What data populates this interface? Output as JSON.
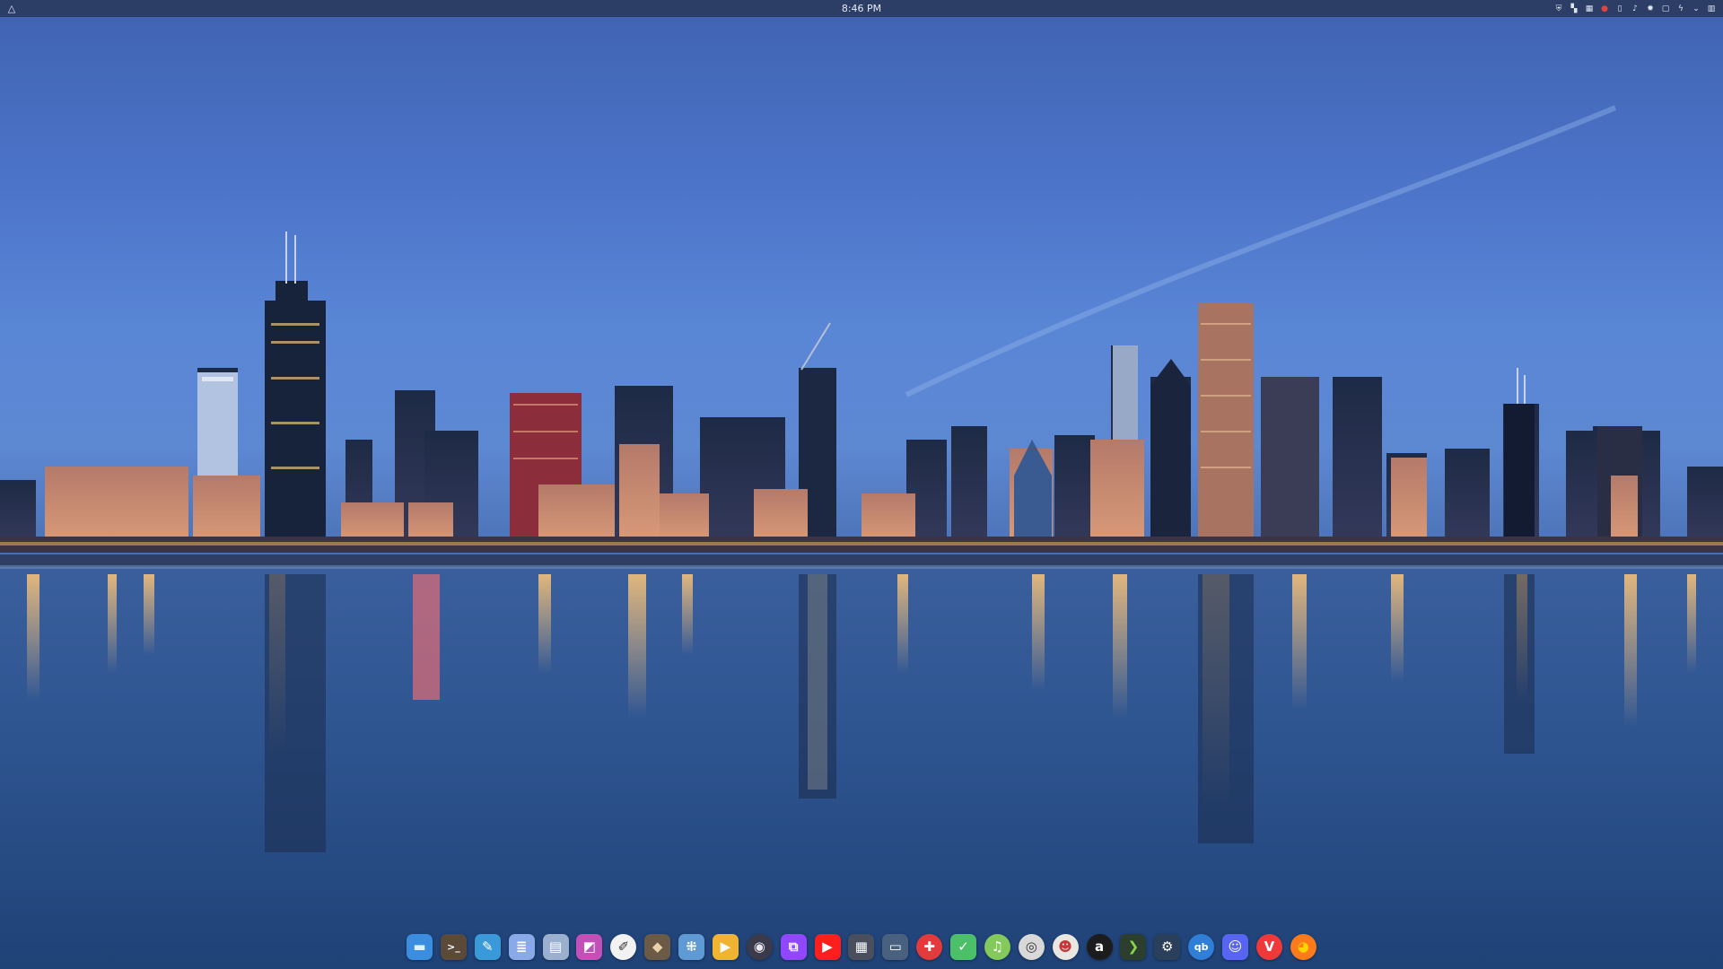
{
  "top_panel": {
    "activities_icon": "triangle-up-icon",
    "clock": "8:46 PM",
    "tray": [
      {
        "icon": "shield-icon",
        "glyph": "⛨",
        "color": "#dfe7f7"
      },
      {
        "icon": "windows-icon",
        "glyph": "▚",
        "color": "#dfe7f7"
      },
      {
        "icon": "grid-icon",
        "glyph": "▦",
        "color": "#dfe7f7"
      },
      {
        "icon": "record-icon",
        "glyph": "●",
        "color": "#e0443e"
      },
      {
        "icon": "clipboard-icon",
        "glyph": "▯",
        "color": "#dfe7f7"
      },
      {
        "icon": "volume-icon",
        "glyph": "♪",
        "color": "#dfe7f7"
      },
      {
        "icon": "brightness-icon",
        "glyph": "✹",
        "color": "#dfe7f7"
      },
      {
        "icon": "display-icon",
        "glyph": "▢",
        "color": "#dfe7f7"
      },
      {
        "icon": "power-icon",
        "glyph": "ϟ",
        "color": "#dfe7f7"
      },
      {
        "icon": "chevron-down-icon",
        "glyph": "⌄",
        "color": "#dfe7f7"
      },
      {
        "icon": "trash-icon",
        "glyph": "▥",
        "color": "#dfe7f7"
      }
    ]
  },
  "dock": {
    "apps": [
      {
        "name": "files",
        "icon": "folder-icon",
        "glyph": "▬",
        "bg": "#3b8de0",
        "fg": "#dff0ff",
        "round": false
      },
      {
        "name": "terminal",
        "icon": "terminal-icon",
        "glyph": ">_",
        "bg": "#5b4a3a",
        "fg": "#ffffff",
        "round": false
      },
      {
        "name": "text-editor",
        "icon": "pencil-icon",
        "glyph": "✎",
        "bg": "#3a9ad9",
        "fg": "#ffffff",
        "round": false
      },
      {
        "name": "document-viewer",
        "icon": "document-icon",
        "glyph": "≣",
        "bg": "#8aa9e8",
        "fg": "#ffffff",
        "round": false
      },
      {
        "name": "archive-manager",
        "icon": "archive-icon",
        "glyph": "▤",
        "bg": "#9bb0cf",
        "fg": "#ffffff",
        "round": false
      },
      {
        "name": "image-viewer",
        "icon": "image-icon",
        "glyph": "◩",
        "bg": "#c34fb8",
        "fg": "#ffffff",
        "round": false
      },
      {
        "name": "color-picker",
        "icon": "brush-icon",
        "glyph": "✐",
        "bg": "#f2f2f2",
        "fg": "#333333",
        "round": true
      },
      {
        "name": "gimp",
        "icon": "gimp-icon",
        "glyph": "◆",
        "bg": "#6b5a45",
        "fg": "#e8d2a8",
        "round": false
      },
      {
        "name": "remote-desktop",
        "icon": "network-icon",
        "glyph": "⁜",
        "bg": "#5f9ad4",
        "fg": "#ffffff",
        "round": false
      },
      {
        "name": "slides",
        "icon": "presentation-icon",
        "glyph": "▶",
        "bg": "#f0b431",
        "fg": "#ffffff",
        "round": false
      },
      {
        "name": "obs-studio",
        "icon": "record-icon",
        "glyph": "◉",
        "bg": "#3a3a4a",
        "fg": "#e8e8f0",
        "round": true
      },
      {
        "name": "twitch",
        "icon": "twitch-icon",
        "glyph": "⧉",
        "bg": "#9146ff",
        "fg": "#ffffff",
        "round": false
      },
      {
        "name": "youtube",
        "icon": "youtube-icon",
        "glyph": "▶",
        "bg": "#ff1e1e",
        "fg": "#ffffff",
        "round": false
      },
      {
        "name": "video-editor",
        "icon": "film-icon",
        "glyph": "▦",
        "bg": "#4a4f5e",
        "fg": "#ffffff",
        "round": false
      },
      {
        "name": "screen-recorder",
        "icon": "monitor-icon",
        "glyph": "▭",
        "bg": "#49617f",
        "fg": "#ffffff",
        "round": false
      },
      {
        "name": "help-center",
        "icon": "lifebuoy-icon",
        "glyph": "✚",
        "bg": "#e33b3b",
        "fg": "#ffffff",
        "round": true
      },
      {
        "name": "tag-editor",
        "icon": "tag-icon",
        "glyph": "✓",
        "bg": "#4cbf6a",
        "fg": "#ffffff",
        "round": false
      },
      {
        "name": "music-player",
        "icon": "music-icon",
        "glyph": "♫",
        "bg": "#84c95b",
        "fg": "#ffffff",
        "round": true
      },
      {
        "name": "disk-utility",
        "icon": "disk-icon",
        "glyph": "◎",
        "bg": "#d8d8d8",
        "fg": "#333333",
        "round": true
      },
      {
        "name": "media-player",
        "icon": "cartoon-icon",
        "glyph": "☻",
        "bg": "#eae6e2",
        "fg": "#c43a3a",
        "round": true
      },
      {
        "name": "amazon-music",
        "icon": "letter-a-icon",
        "glyph": "a",
        "bg": "#1c1c1c",
        "fg": "#ffffff",
        "round": true
      },
      {
        "name": "plex",
        "icon": "play-chevron-icon",
        "glyph": "❯",
        "bg": "#2c3e2d",
        "fg": "#8ad34a",
        "round": false
      },
      {
        "name": "steam",
        "icon": "steam-icon",
        "glyph": "⚙",
        "bg": "#2a3f5a",
        "fg": "#ffffff",
        "round": false
      },
      {
        "name": "qbittorrent",
        "icon": "qbittorrent-icon",
        "glyph": "qb",
        "bg": "#2f7fd9",
        "fg": "#ffffff",
        "round": true
      },
      {
        "name": "discord",
        "icon": "discord-icon",
        "glyph": "☺",
        "bg": "#5865f2",
        "fg": "#ffffff",
        "round": false
      },
      {
        "name": "vivaldi",
        "icon": "vivaldi-icon",
        "glyph": "V",
        "bg": "#ef3939",
        "fg": "#ffffff",
        "round": true
      },
      {
        "name": "firefox",
        "icon": "firefox-icon",
        "glyph": "◕",
        "bg": "#ff7a1a",
        "fg": "#ffd400",
        "round": true
      }
    ]
  }
}
